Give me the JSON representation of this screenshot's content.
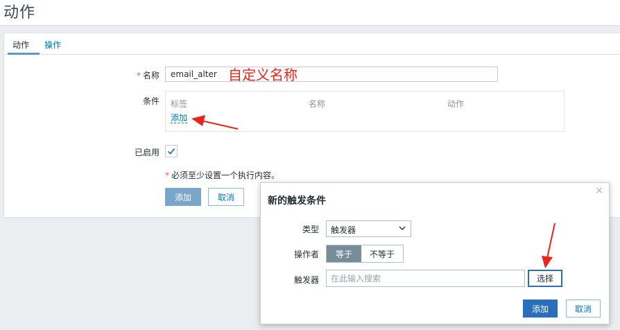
{
  "page": {
    "title": "动作"
  },
  "tabs": [
    {
      "label": "动作"
    },
    {
      "label": "操作"
    }
  ],
  "form": {
    "name_label": "名称",
    "name_value": "email_alter",
    "annotation": "自定义名称",
    "conditions_label": "条件",
    "cond_columns": [
      "标签",
      "名称",
      "动作"
    ],
    "cond_add_link": "添加",
    "enabled_label": "已启用",
    "enabled_checked": true,
    "note": "必须至少设置一个执行内容。",
    "add_button": "添加",
    "cancel_button": "取消"
  },
  "dialog": {
    "title": "新的触发条件",
    "type_label": "类型",
    "type_value": "触发器",
    "operator_label": "操作者",
    "operator_options": [
      "等于",
      "不等于"
    ],
    "operator_selected": "等于",
    "trigger_label": "触发器",
    "trigger_placeholder": "在此输入搜索",
    "select_button": "选择",
    "add_button": "添加",
    "cancel_button": "取消",
    "close_icon": "close-icon"
  },
  "colors": {
    "accent": "#0275b8",
    "primary_button": "#2a6fb7",
    "annotation_red": "#e8241b"
  }
}
